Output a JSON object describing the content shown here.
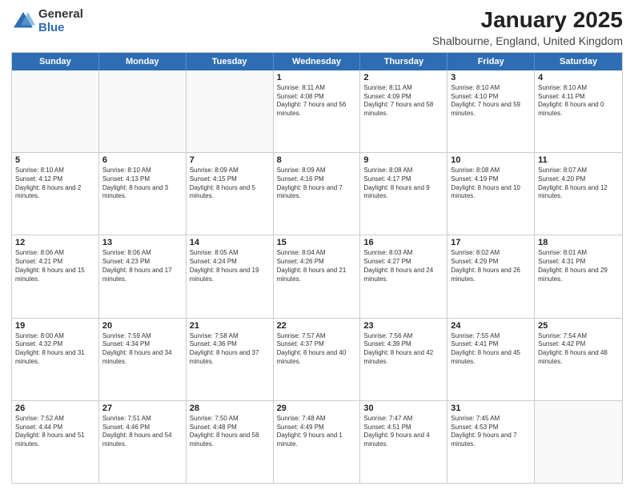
{
  "logo": {
    "general": "General",
    "blue": "Blue"
  },
  "title": "January 2025",
  "subtitle": "Shalbourne, England, United Kingdom",
  "header_days": [
    "Sunday",
    "Monday",
    "Tuesday",
    "Wednesday",
    "Thursday",
    "Friday",
    "Saturday"
  ],
  "weeks": [
    [
      {
        "day": "",
        "sunrise": "",
        "sunset": "",
        "daylight": "",
        "empty": true
      },
      {
        "day": "",
        "sunrise": "",
        "sunset": "",
        "daylight": "",
        "empty": true
      },
      {
        "day": "",
        "sunrise": "",
        "sunset": "",
        "daylight": "",
        "empty": true
      },
      {
        "day": "1",
        "sunrise": "Sunrise: 8:11 AM",
        "sunset": "Sunset: 4:08 PM",
        "daylight": "Daylight: 7 hours and 56 minutes.",
        "empty": false
      },
      {
        "day": "2",
        "sunrise": "Sunrise: 8:11 AM",
        "sunset": "Sunset: 4:09 PM",
        "daylight": "Daylight: 7 hours and 58 minutes.",
        "empty": false
      },
      {
        "day": "3",
        "sunrise": "Sunrise: 8:10 AM",
        "sunset": "Sunset: 4:10 PM",
        "daylight": "Daylight: 7 hours and 59 minutes.",
        "empty": false
      },
      {
        "day": "4",
        "sunrise": "Sunrise: 8:10 AM",
        "sunset": "Sunset: 4:11 PM",
        "daylight": "Daylight: 8 hours and 0 minutes.",
        "empty": false
      }
    ],
    [
      {
        "day": "5",
        "sunrise": "Sunrise: 8:10 AM",
        "sunset": "Sunset: 4:12 PM",
        "daylight": "Daylight: 8 hours and 2 minutes.",
        "empty": false
      },
      {
        "day": "6",
        "sunrise": "Sunrise: 8:10 AM",
        "sunset": "Sunset: 4:13 PM",
        "daylight": "Daylight: 8 hours and 3 minutes.",
        "empty": false
      },
      {
        "day": "7",
        "sunrise": "Sunrise: 8:09 AM",
        "sunset": "Sunset: 4:15 PM",
        "daylight": "Daylight: 8 hours and 5 minutes.",
        "empty": false
      },
      {
        "day": "8",
        "sunrise": "Sunrise: 8:09 AM",
        "sunset": "Sunset: 4:16 PM",
        "daylight": "Daylight: 8 hours and 7 minutes.",
        "empty": false
      },
      {
        "day": "9",
        "sunrise": "Sunrise: 8:08 AM",
        "sunset": "Sunset: 4:17 PM",
        "daylight": "Daylight: 8 hours and 9 minutes.",
        "empty": false
      },
      {
        "day": "10",
        "sunrise": "Sunrise: 8:08 AM",
        "sunset": "Sunset: 4:19 PM",
        "daylight": "Daylight: 8 hours and 10 minutes.",
        "empty": false
      },
      {
        "day": "11",
        "sunrise": "Sunrise: 8:07 AM",
        "sunset": "Sunset: 4:20 PM",
        "daylight": "Daylight: 8 hours and 12 minutes.",
        "empty": false
      }
    ],
    [
      {
        "day": "12",
        "sunrise": "Sunrise: 8:06 AM",
        "sunset": "Sunset: 4:21 PM",
        "daylight": "Daylight: 8 hours and 15 minutes.",
        "empty": false
      },
      {
        "day": "13",
        "sunrise": "Sunrise: 8:06 AM",
        "sunset": "Sunset: 4:23 PM",
        "daylight": "Daylight: 8 hours and 17 minutes.",
        "empty": false
      },
      {
        "day": "14",
        "sunrise": "Sunrise: 8:05 AM",
        "sunset": "Sunset: 4:24 PM",
        "daylight": "Daylight: 8 hours and 19 minutes.",
        "empty": false
      },
      {
        "day": "15",
        "sunrise": "Sunrise: 8:04 AM",
        "sunset": "Sunset: 4:26 PM",
        "daylight": "Daylight: 8 hours and 21 minutes.",
        "empty": false
      },
      {
        "day": "16",
        "sunrise": "Sunrise: 8:03 AM",
        "sunset": "Sunset: 4:27 PM",
        "daylight": "Daylight: 8 hours and 24 minutes.",
        "empty": false
      },
      {
        "day": "17",
        "sunrise": "Sunrise: 8:02 AM",
        "sunset": "Sunset: 4:29 PM",
        "daylight": "Daylight: 8 hours and 26 minutes.",
        "empty": false
      },
      {
        "day": "18",
        "sunrise": "Sunrise: 8:01 AM",
        "sunset": "Sunset: 4:31 PM",
        "daylight": "Daylight: 8 hours and 29 minutes.",
        "empty": false
      }
    ],
    [
      {
        "day": "19",
        "sunrise": "Sunrise: 8:00 AM",
        "sunset": "Sunset: 4:32 PM",
        "daylight": "Daylight: 8 hours and 31 minutes.",
        "empty": false
      },
      {
        "day": "20",
        "sunrise": "Sunrise: 7:59 AM",
        "sunset": "Sunset: 4:34 PM",
        "daylight": "Daylight: 8 hours and 34 minutes.",
        "empty": false
      },
      {
        "day": "21",
        "sunrise": "Sunrise: 7:58 AM",
        "sunset": "Sunset: 4:36 PM",
        "daylight": "Daylight: 8 hours and 37 minutes.",
        "empty": false
      },
      {
        "day": "22",
        "sunrise": "Sunrise: 7:57 AM",
        "sunset": "Sunset: 4:37 PM",
        "daylight": "Daylight: 8 hours and 40 minutes.",
        "empty": false
      },
      {
        "day": "23",
        "sunrise": "Sunrise: 7:56 AM",
        "sunset": "Sunset: 4:39 PM",
        "daylight": "Daylight: 8 hours and 42 minutes.",
        "empty": false
      },
      {
        "day": "24",
        "sunrise": "Sunrise: 7:55 AM",
        "sunset": "Sunset: 4:41 PM",
        "daylight": "Daylight: 8 hours and 45 minutes.",
        "empty": false
      },
      {
        "day": "25",
        "sunrise": "Sunrise: 7:54 AM",
        "sunset": "Sunset: 4:42 PM",
        "daylight": "Daylight: 8 hours and 48 minutes.",
        "empty": false
      }
    ],
    [
      {
        "day": "26",
        "sunrise": "Sunrise: 7:52 AM",
        "sunset": "Sunset: 4:44 PM",
        "daylight": "Daylight: 8 hours and 51 minutes.",
        "empty": false
      },
      {
        "day": "27",
        "sunrise": "Sunrise: 7:51 AM",
        "sunset": "Sunset: 4:46 PM",
        "daylight": "Daylight: 8 hours and 54 minutes.",
        "empty": false
      },
      {
        "day": "28",
        "sunrise": "Sunrise: 7:50 AM",
        "sunset": "Sunset: 4:48 PM",
        "daylight": "Daylight: 8 hours and 58 minutes.",
        "empty": false
      },
      {
        "day": "29",
        "sunrise": "Sunrise: 7:48 AM",
        "sunset": "Sunset: 4:49 PM",
        "daylight": "Daylight: 9 hours and 1 minute.",
        "empty": false
      },
      {
        "day": "30",
        "sunrise": "Sunrise: 7:47 AM",
        "sunset": "Sunset: 4:51 PM",
        "daylight": "Daylight: 9 hours and 4 minutes.",
        "empty": false
      },
      {
        "day": "31",
        "sunrise": "Sunrise: 7:45 AM",
        "sunset": "Sunset: 4:53 PM",
        "daylight": "Daylight: 9 hours and 7 minutes.",
        "empty": false
      },
      {
        "day": "",
        "sunrise": "",
        "sunset": "",
        "daylight": "",
        "empty": true
      }
    ]
  ]
}
